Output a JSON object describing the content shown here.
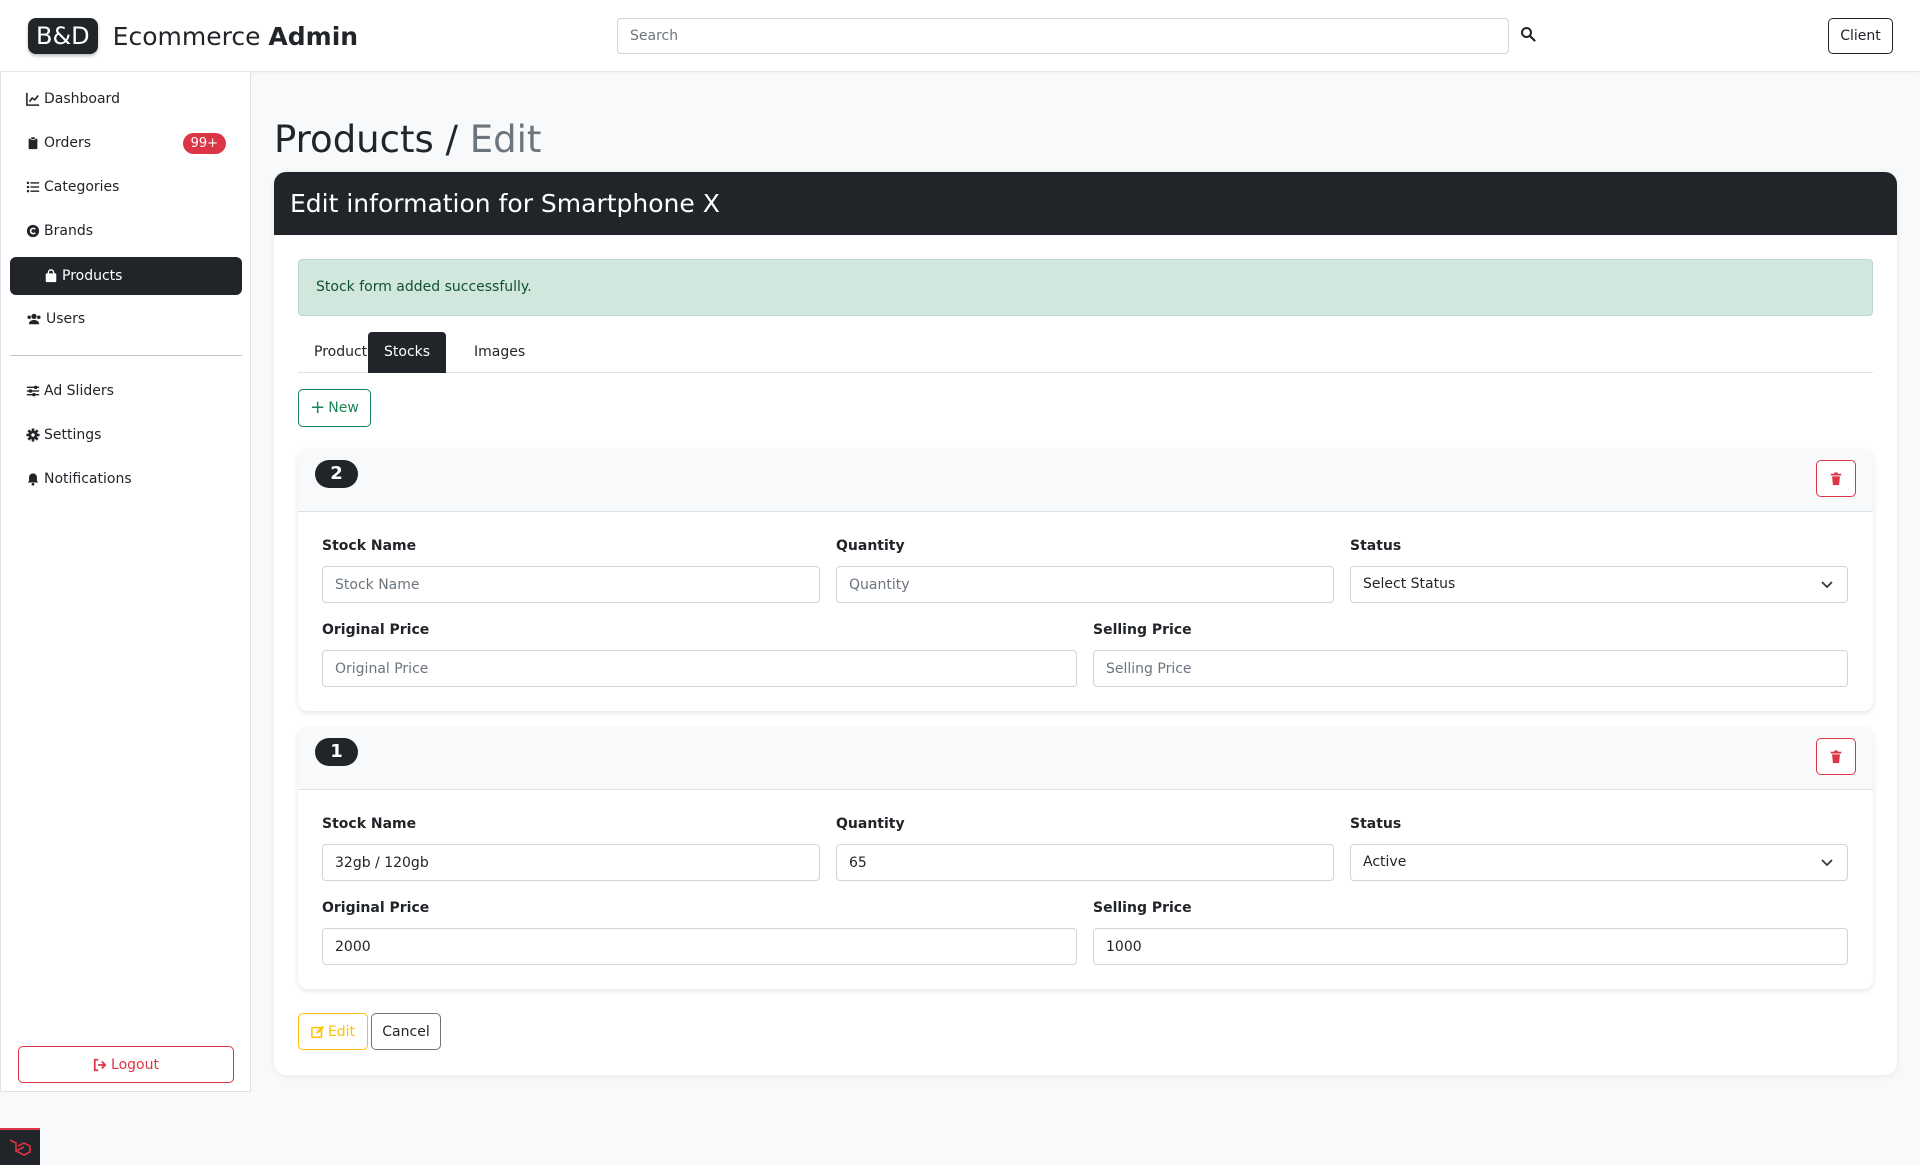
{
  "header": {
    "logo_text": "B&D",
    "app_name": "Ecommerce",
    "app_name_bold": "Admin",
    "search_placeholder": "Search",
    "client_label": "Client"
  },
  "sidebar": {
    "items": [
      {
        "label": "Dashboard",
        "icon": "chart-line-icon"
      },
      {
        "label": "Orders",
        "icon": "clipboard-icon",
        "badge": "99+"
      },
      {
        "label": "Categories",
        "icon": "list-icon"
      },
      {
        "label": "Brands",
        "icon": "copyright-icon"
      },
      {
        "label": "Products",
        "icon": "shopping-bag-icon",
        "active": true
      },
      {
        "label": "Users",
        "icon": "users-icon"
      },
      {
        "label": "Ad Sliders",
        "icon": "sliders-icon"
      },
      {
        "label": "Settings",
        "icon": "gear-icon"
      },
      {
        "label": "Notifications",
        "icon": "bell-icon"
      }
    ],
    "logout_label": "Logout"
  },
  "page": {
    "title": "Products /",
    "title_muted": "Edit"
  },
  "card": {
    "header": "Edit information for Smartphone X",
    "alert": "Stock form added successfully.",
    "tabs": [
      "Product",
      "Stocks",
      "Images"
    ],
    "active_tab": "Stocks",
    "new_label": "New"
  },
  "stocks": [
    {
      "number": "2",
      "stock_name_label": "Stock Name",
      "stock_name_value": "",
      "stock_name_placeholder": "Stock Name",
      "quantity_label": "Quantity",
      "quantity_value": "",
      "quantity_placeholder": "Quantity",
      "status_label": "Status",
      "status_value": "Select Status",
      "original_price_label": "Original Price",
      "original_price_value": "",
      "original_price_placeholder": "Original Price",
      "selling_price_label": "Selling Price",
      "selling_price_value": "",
      "selling_price_placeholder": "Selling Price"
    },
    {
      "number": "1",
      "stock_name_label": "Stock Name",
      "stock_name_value": "32gb / 120gb",
      "stock_name_placeholder": "Stock Name",
      "quantity_label": "Quantity",
      "quantity_value": "65",
      "quantity_placeholder": "Quantity",
      "status_label": "Status",
      "status_value": "Active",
      "original_price_label": "Original Price",
      "original_price_value": "2000",
      "original_price_placeholder": "Original Price",
      "selling_price_label": "Selling Price",
      "selling_price_value": "1000",
      "selling_price_placeholder": "Selling Price"
    }
  ],
  "actions": {
    "edit_label": "Edit",
    "cancel_label": "Cancel"
  },
  "colors": {
    "dark": "#212529",
    "danger": "#dc3545",
    "success": "#198754",
    "warning": "#ffc107",
    "alert_bg": "#d1e7dd"
  }
}
